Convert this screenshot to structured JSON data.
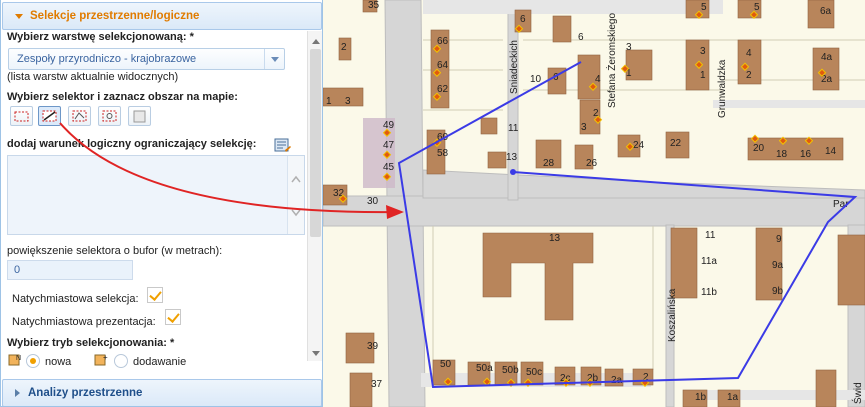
{
  "panel": {
    "section_title": "Selekcje przestrzenne/logiczne",
    "layer_label": "Wybierz warstwę selekcjonowaną: *",
    "layer_value": "Zespoły przyrodniczo - krajobrazowe",
    "layer_note": "(lista warstw aktualnie widocznych)",
    "selector_label": "Wybierz selektor i zaznacz obszar na mapie:",
    "condition_label": "dodaj warunek logiczny ograniczający selekcję:",
    "buffer_label": "powiększenie selektora o bufor (w metrach):",
    "buffer_value": "0",
    "instant_selection_label": "Natychmiastowa selekcja:",
    "instant_presentation_label": "Natychmiastowa prezentacja:",
    "mode_label": "Wybierz tryb selekcjonowania: *",
    "mode_new": "nowa",
    "mode_add": "dodawanie",
    "next_section_title": "Analizy przestrzenne"
  },
  "tools": [
    "rectangle-selector-icon",
    "polygon-selector-icon",
    "polygon-alt-selector-icon",
    "circle-selector-icon",
    "clear-selector-icon"
  ],
  "colors": {
    "accent": "#e07b00",
    "selection": "#3b3be6",
    "arrow": "#e02424",
    "building": "#b8855b",
    "road": "#d3d3d3"
  },
  "map": {
    "streets": [
      "Sniadeckich",
      "Stefana Żeromskiego",
      "Grunwaldzka",
      "Koszalińska",
      "Par",
      "Świd"
    ],
    "numbers": [
      "35",
      "5",
      "5",
      "6a",
      "2",
      "6",
      "6",
      "66",
      "64",
      "62",
      "10",
      "4",
      "3",
      "1",
      "4",
      "4a",
      "2a",
      "3",
      "1",
      "1",
      "3",
      "49",
      "47",
      "45",
      "60",
      "58",
      "11",
      "13",
      "28",
      "26",
      "2",
      "24",
      "22",
      "20",
      "18",
      "16",
      "14",
      "32",
      "30",
      "13",
      "11",
      "11a",
      "11b",
      "9",
      "9a",
      "9b",
      "39",
      "37",
      "50",
      "50a",
      "50b",
      "50c",
      "2c",
      "2b",
      "2a",
      "2",
      "1b",
      "1a"
    ]
  }
}
